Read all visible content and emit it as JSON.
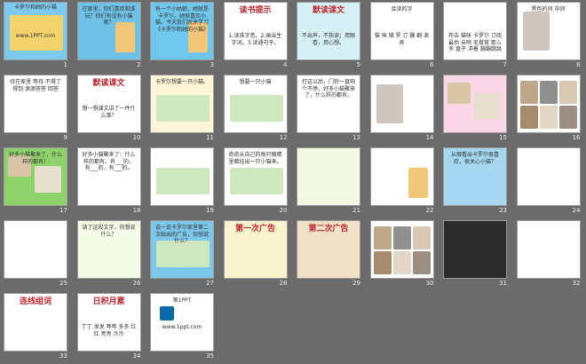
{
  "app": {
    "view": "slide-sorter"
  },
  "slides": [
    {
      "n": "1",
      "title": "卡罗尔和她的小猫",
      "sub": "www.1PPT.com",
      "bg": "#7ec9ef",
      "theme": "title"
    },
    {
      "n": "2",
      "title": "在家里，你们喜欢和谁玩？你们有没有小猫呢？",
      "bg": "#6fc2e6",
      "theme": "girl"
    },
    {
      "n": "3",
      "title": "有一个小姑娘，她就是卡罗尔。她很喜欢小猫。今天我们就来学习《卡罗尔和她的小猫》",
      "bg": "#70c7ec",
      "theme": "girl"
    },
    {
      "n": "4",
      "title": "读书提示",
      "sub": "1.读准字音。2.画出生字词。3.读通句子。",
      "bg": "#ffffff",
      "theme": "text"
    },
    {
      "n": "5",
      "title": "默读课文",
      "sub": "不出声，不指读；用眼看，用心想。",
      "bg": "#d6f1f5",
      "theme": "text"
    },
    {
      "n": "6",
      "title": "会读的字",
      "sub": "猫 咪 铺 罗 订 蹦 翻 滚 弄",
      "bg": "#ffffff",
      "theme": "chars"
    },
    {
      "n": "7",
      "title": "",
      "sub": "布告 猫咪 卡罗尔 订阅 最后 亲吻 毛茸茸 那么多 盘子 冲着 蹦蹦跳跳",
      "bg": "#ffffff",
      "theme": "words"
    },
    {
      "n": "8",
      "title": "黑色的间 中间",
      "bg": "#ffffff",
      "theme": "cat"
    },
    {
      "n": "9",
      "title": "待在家里 等待 不得了 得到 滴滴答答 回答",
      "bg": "#ffffff",
      "theme": "text"
    },
    {
      "n": "10",
      "title": "默读课文",
      "sub": "想一想课文讲了一件什么事？",
      "bg": "#ffffff",
      "theme": "text"
    },
    {
      "n": "11",
      "title": "卡罗尔想要一只小猫。",
      "bg": "#fff6d8",
      "theme": "scene"
    },
    {
      "n": "12",
      "title": "想要一只小猫",
      "bg": "#ffffff",
      "theme": "scene"
    },
    {
      "n": "13",
      "title": "打这以后，门铃一直响个不停。好多小猫聚来了，什么样的都有。",
      "bg": "#ffffff",
      "theme": "text"
    },
    {
      "n": "14",
      "title": "",
      "bg": "#ffffff",
      "theme": "cat"
    },
    {
      "n": "15",
      "title": "",
      "bg": "#f9d7e6",
      "theme": "cats"
    },
    {
      "n": "16",
      "title": "",
      "bg": "#ffffff",
      "theme": "collage"
    },
    {
      "n": "17",
      "title": "好多小猫聚来了，什么样的都有！",
      "bg": "#8fd16a",
      "theme": "cats"
    },
    {
      "n": "18",
      "title": "好多小猫聚来了：什么样的都有。有___的，有___的，有___的。",
      "bg": "#ffffff",
      "theme": "text"
    },
    {
      "n": "19",
      "title": "",
      "bg": "#ffffff",
      "theme": "scene"
    },
    {
      "n": "20",
      "title": "奇奇从自己的每只眼睛里都挂出一只小猫来。",
      "bg": "#ffffff",
      "theme": "scene"
    },
    {
      "n": "21",
      "title": "",
      "bg": "#f4f9e4",
      "theme": "text"
    },
    {
      "n": "22",
      "title": "",
      "bg": "#ffffff",
      "theme": "girl"
    },
    {
      "n": "23",
      "title": "从哪看出卡罗尔很喜欢、很关心小猫？",
      "bg": "#a3d8f0",
      "theme": "text"
    },
    {
      "n": "24",
      "title": "",
      "bg": "#ffffff",
      "theme": "text"
    },
    {
      "n": "25",
      "title": "",
      "bg": "#ffffff",
      "theme": "text"
    },
    {
      "n": "26",
      "title": "读了这段文字，你想说什么？",
      "bg": "#f5fbe7",
      "theme": "text"
    },
    {
      "n": "27",
      "title": "说一说卡罗尔家里第二次贴出的广告，你想说什么？",
      "bg": "#7cc8ea",
      "theme": "scene"
    },
    {
      "n": "28",
      "title": "第一次广告",
      "bg": "#f8f2cf",
      "theme": "text"
    },
    {
      "n": "29",
      "title": "第二次广告",
      "bg": "#f2e2c8",
      "theme": "text"
    },
    {
      "n": "30",
      "title": "",
      "bg": "#ffffff",
      "theme": "collage"
    },
    {
      "n": "31",
      "title": "",
      "bg": "#2a2a2a",
      "theme": "text"
    },
    {
      "n": "32",
      "title": "",
      "bg": "#ffffff",
      "theme": "text"
    },
    {
      "n": "33",
      "title": "连线组词",
      "bg": "#ffffff",
      "theme": "text"
    },
    {
      "n": "34",
      "title": "日积月累",
      "sub": "丁丁 发发 哗哗 多多 红红 亮亮 冷冷",
      "bg": "#ffffff",
      "theme": "text"
    },
    {
      "n": "35",
      "title": "第1PPT",
      "sub": "www.1ppt.com",
      "bg": "#ffffff",
      "theme": "logo"
    }
  ]
}
